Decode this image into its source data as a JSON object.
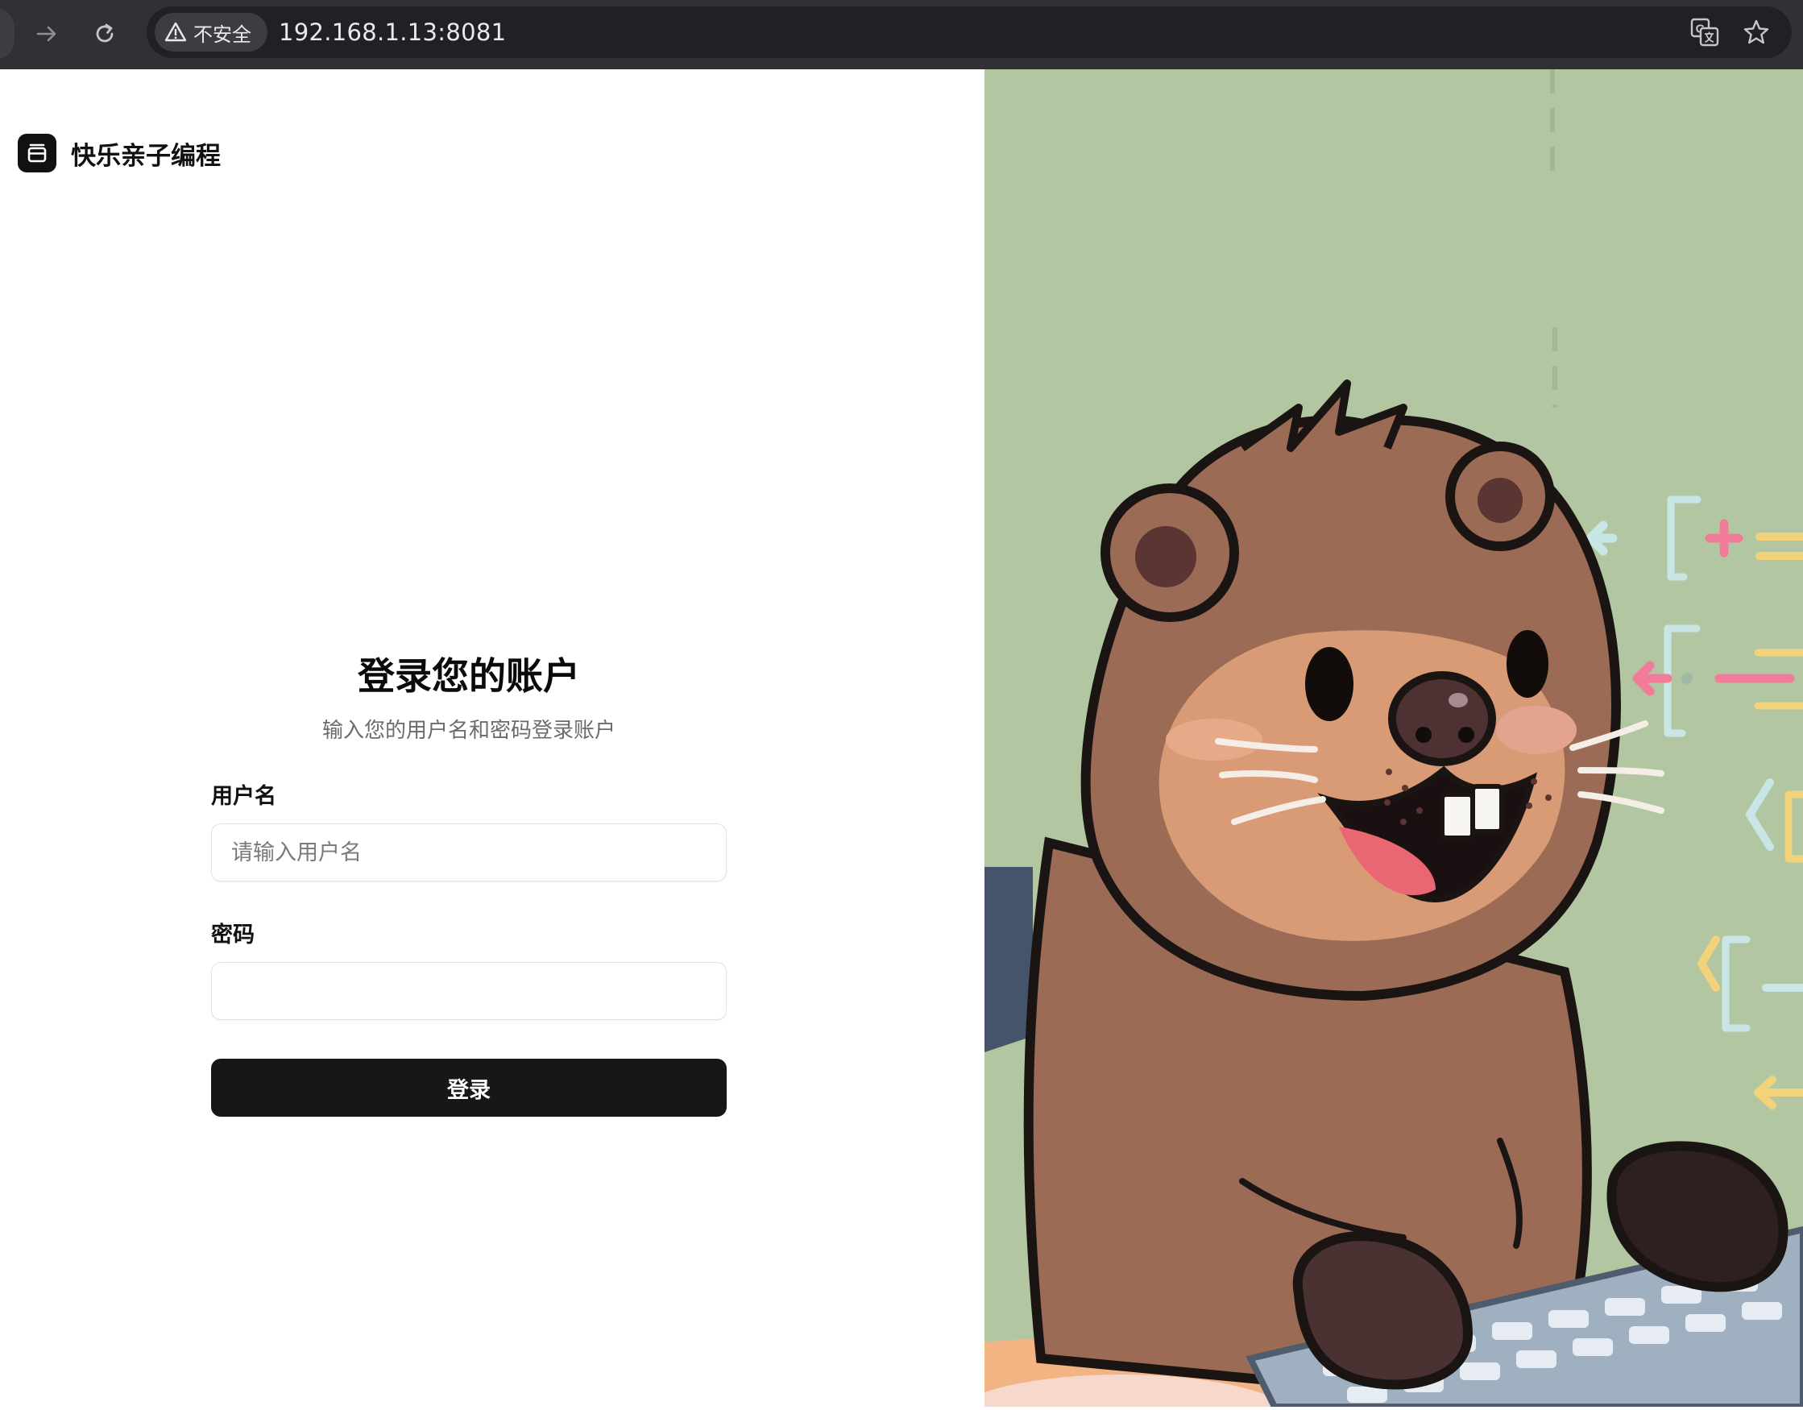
{
  "browser": {
    "security_label": "不安全",
    "url": "192.168.1.13:8081"
  },
  "brand": {
    "name": "快乐亲子编程"
  },
  "login": {
    "title": "登录您的账户",
    "subtitle": "输入您的用户名和密码登录账户",
    "username_label": "用户名",
    "username_placeholder": "请输入用户名",
    "username_value": "",
    "password_label": "密码",
    "password_value": "",
    "submit_label": "登录"
  },
  "illustration": {
    "subject": "cartoon beaver typing on a keyboard in front of a chalkboard with code symbols"
  },
  "colors": {
    "chrome": "#303134",
    "omnibox": "#202124",
    "button": "#171717",
    "illustration_bg": "#b2c7a1",
    "beaver_fur": "#9b6b56",
    "beaver_muzzle": "#d99b76"
  }
}
